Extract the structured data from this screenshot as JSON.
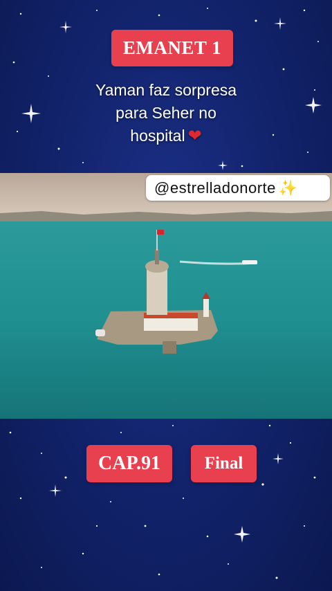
{
  "header": {
    "title": "EMANET 1"
  },
  "caption": {
    "line1": "Yaman faz sorpresa",
    "line2": "para Seher no",
    "line3": "hospital",
    "emoji": "red-heart-icon"
  },
  "overlay": {
    "handle": "@estrelladonorte",
    "emoji": "dizzy-sparkle-icon"
  },
  "footer": {
    "episode": "CAP.91",
    "status": "Final"
  },
  "colors": {
    "badge": "#e8404e",
    "background": "#13246e",
    "sea": "#1f8f90"
  }
}
